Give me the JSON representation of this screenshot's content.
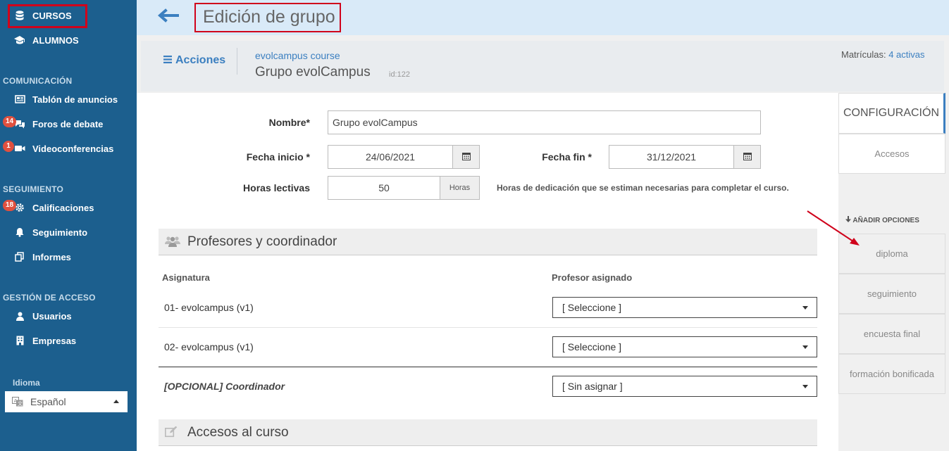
{
  "colors": {
    "sidebar_bg": "#1c5f8e",
    "accent": "#3b7fc0",
    "highlight_red": "#d0021b",
    "badge": "#e0503f",
    "topbar_bg": "#d9eaf8"
  },
  "sidebar": {
    "items": [
      {
        "label": "CURSOS",
        "icon": "database-icon"
      },
      {
        "label": "ALUMNOS",
        "icon": "graduation-cap-icon"
      }
    ],
    "sections": [
      {
        "title": "COMUNICACIÓN",
        "items": [
          {
            "label": "Tablón de anuncios",
            "icon": "newspaper-icon"
          },
          {
            "label": "Foros de debate",
            "icon": "comments-icon",
            "badge": "14"
          },
          {
            "label": "Videoconferencias",
            "icon": "video-camera-icon",
            "badge": "1"
          }
        ]
      },
      {
        "title": "SEGUIMIENTO",
        "items": [
          {
            "label": "Calificaciones",
            "icon": "gear-icon",
            "badge": "18"
          },
          {
            "label": "Seguimiento",
            "icon": "bell-icon"
          },
          {
            "label": "Informes",
            "icon": "copy-icon"
          }
        ]
      },
      {
        "title": "GESTIÓN DE ACCESO",
        "items": [
          {
            "label": "Usuarios",
            "icon": "user-icon"
          },
          {
            "label": "Empresas",
            "icon": "building-icon"
          }
        ]
      }
    ],
    "language": {
      "label": "Idioma",
      "value": "Español"
    }
  },
  "topbar": {
    "title": "Edición de grupo"
  },
  "header": {
    "actions_label": "Acciones",
    "course_link": "evolcampus course",
    "group_name": "Grupo evolCampus",
    "group_id": "id:122",
    "enrollments_label": "Matrículas:",
    "enrollments_value": "4 activas"
  },
  "form": {
    "name_label": "Nombre*",
    "name_value": "Grupo evolCampus",
    "start_label": "Fecha inicio *",
    "start_value": "24/06/2021",
    "end_label": "Fecha fin *",
    "end_value": "31/12/2021",
    "hours_label": "Horas lectivas",
    "hours_value": "50",
    "hours_unit": "Horas",
    "hours_help": "Horas de dedicación que se estiman necesarias para completar el curso."
  },
  "teachers": {
    "title": "Profesores y coordinador",
    "col_subject": "Asignatura",
    "col_teacher": "Profesor asignado",
    "rows": [
      {
        "subject": "01- evolcampus (v1)",
        "teacher": "[ Seleccione ]"
      },
      {
        "subject": "02- evolcampus (v1)",
        "teacher": "[ Seleccione ]"
      },
      {
        "subject": "[OPCIONAL] Coordinador",
        "teacher": "[ Sin asignar ]"
      }
    ]
  },
  "access_section": {
    "title": "Accesos al curso"
  },
  "right_panel": {
    "tabs": [
      "CONFIGURACIÓN",
      "Accesos"
    ],
    "add_options_label": "AÑADIR OPCIONES",
    "options": [
      "diploma",
      "seguimiento",
      "encuesta final",
      "formación bonificada"
    ]
  }
}
